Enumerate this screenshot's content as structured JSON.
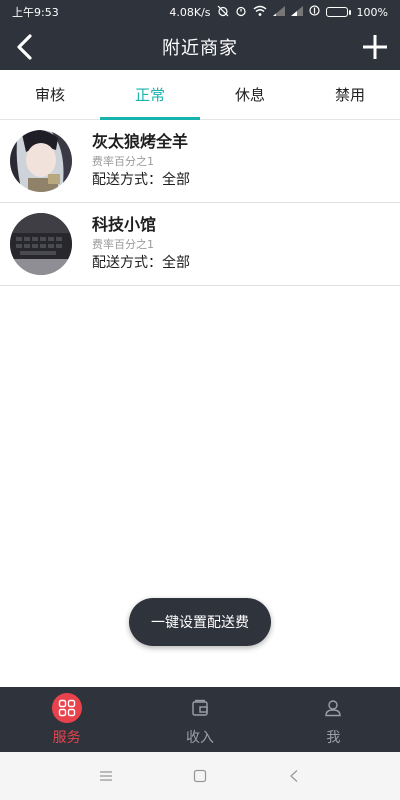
{
  "status_bar": {
    "time": "上午9:53",
    "network_speed": "4.08K/s",
    "battery": "100%",
    "icons": [
      "alarm-off-icon",
      "alarm-icon",
      "wifi-icon",
      "signal-icon",
      "signal-icon",
      "data-saver-icon",
      "battery-icon"
    ]
  },
  "header": {
    "title": "附近商家",
    "back_icon": "back-icon",
    "add_icon": "add-icon"
  },
  "tabs": [
    {
      "label": "审核",
      "active": false
    },
    {
      "label": "正常",
      "active": true
    },
    {
      "label": "休息",
      "active": false
    },
    {
      "label": "禁用",
      "active": false
    }
  ],
  "merchants": [
    {
      "name": "灰太狼烤全羊",
      "rate": "费率百分之1",
      "delivery": "配送方式：全部"
    },
    {
      "name": "科技小馆",
      "rate": "费率百分之1",
      "delivery": "配送方式：全部"
    }
  ],
  "floating_button": {
    "label": "一键设置配送费"
  },
  "bottom_nav": [
    {
      "label": "服务",
      "icon": "grid-icon",
      "active": true
    },
    {
      "label": "收入",
      "icon": "wallet-icon",
      "active": false
    },
    {
      "label": "我",
      "icon": "person-icon",
      "active": false
    }
  ],
  "system_nav": {
    "icons": [
      "menu-icon",
      "home-icon",
      "back-nav-icon"
    ]
  },
  "colors": {
    "accent": "#17b3ad",
    "bar": "#2f333c",
    "nav_active": "#e8434c"
  }
}
